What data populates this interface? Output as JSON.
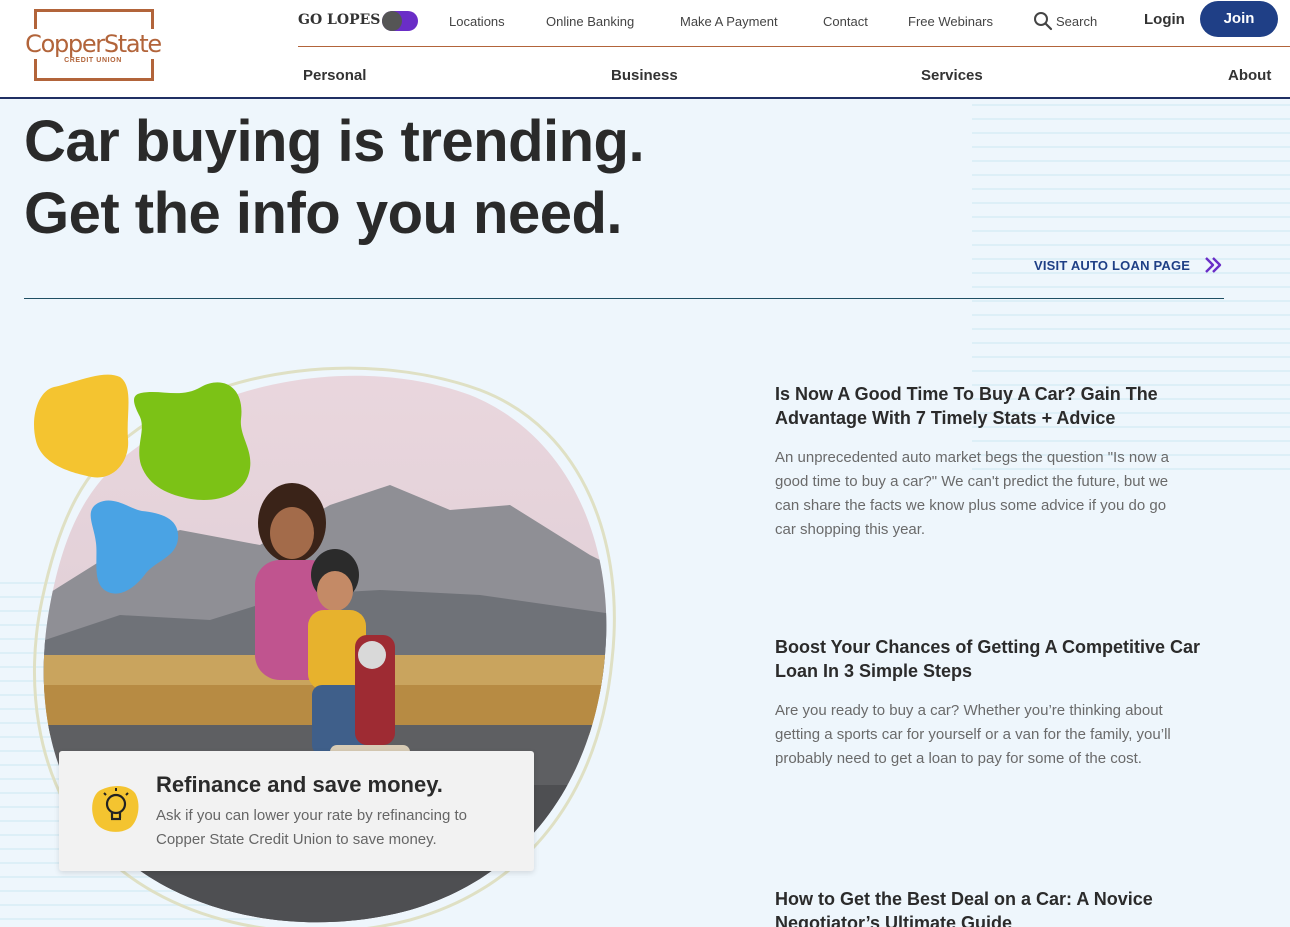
{
  "logo": {
    "name": "CopperState",
    "sub": "CREDIT UNION"
  },
  "utility_nav": {
    "go_lopes": "GO LOPES",
    "links": [
      "Locations",
      "Online Banking",
      "Make A Payment",
      "Contact",
      "Free Webinars"
    ],
    "search_label": "Search",
    "login_label": "Login",
    "join_label": "Join"
  },
  "main_nav": [
    "Personal",
    "Business",
    "Services",
    "About"
  ],
  "hero": {
    "line1": "Car buying is trending.",
    "line2": "Get the info you need.",
    "link_label": "VISIT AUTO LOAN PAGE"
  },
  "promo": {
    "title": "Refinance and save money.",
    "text": "Ask if you can lower your rate by refinancing to Copper State Credit Union to save money."
  },
  "articles": [
    {
      "title": "Is Now A Good Time To Buy A Car? Gain The Advantage With 7 Timely Stats + Advice",
      "excerpt": "An unprecedented auto market begs the question \"Is now a good time to buy a car?\" We can't predict the future, but we can share the facts we know plus some advice if you do go car shopping this year."
    },
    {
      "title": "Boost Your Chances of Getting A Competitive Car Loan In 3 Simple Steps",
      "excerpt": "Are you ready to buy a car? Whether you’re thinking about getting a sports car for yourself or a van for the family, you’ll probably need to get a loan to pay for some of the cost."
    },
    {
      "title": "How to Get the Best Deal on a Car: A Novice Negotiator’s Ultimate Guide",
      "excerpt": ""
    }
  ],
  "colors": {
    "brand_copper": "#b2643a",
    "brand_navy": "#1f3f86",
    "toggle_purple": "#6a2dc7",
    "background": "#eef6fc"
  },
  "icons": [
    "search-icon",
    "double-chevron-right-icon",
    "lightbulb-icon"
  ]
}
